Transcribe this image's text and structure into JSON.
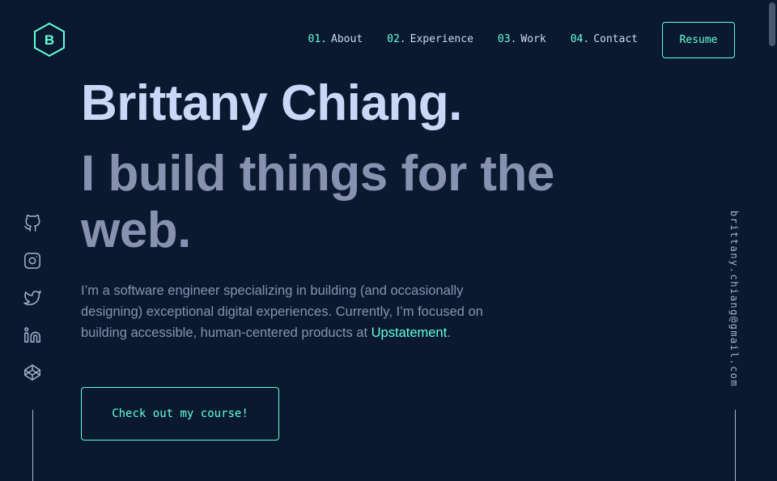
{
  "header": {
    "logo_letter": "B",
    "nav": [
      {
        "num": "01.",
        "label": "About"
      },
      {
        "num": "02.",
        "label": "Experience"
      },
      {
        "num": "03.",
        "label": "Work"
      },
      {
        "num": "04.",
        "label": "Contact"
      }
    ],
    "resume_label": "Resume"
  },
  "hero": {
    "name": "Brittany Chiang.",
    "tagline": "I build things for the web.",
    "intro_before": "I’m a software engineer specializing in building (and occasionally designing) exceptional digital experiences. Currently, I’m focused on building accessible, human-centered products at ",
    "intro_link": "Upstatement",
    "intro_after": ".",
    "cta_label": "Check out my course!"
  },
  "social": {
    "icons": [
      "github-icon",
      "instagram-icon",
      "twitter-icon",
      "linkedin-icon",
      "codepen-icon"
    ]
  },
  "email": "brittany.chiang@gmail.com",
  "colors": {
    "background": "#0a192f",
    "accent": "#64ffda",
    "heading": "#ccd6f6",
    "text": "#8892b0",
    "light": "#a8b2d1"
  }
}
